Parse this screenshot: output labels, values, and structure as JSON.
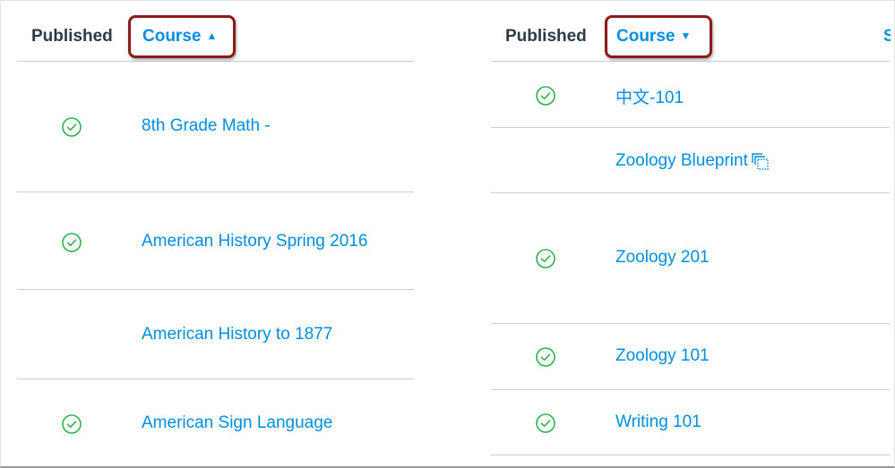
{
  "colors": {
    "link": "#008ee2",
    "published_check": "#2bb34b",
    "header_text": "#2d3b45",
    "highlight": "#8b1a1a",
    "divider": "#c7cdd1"
  },
  "left_table": {
    "headers": {
      "published": "Published",
      "course": "Course",
      "sort_direction": "ascending",
      "sort_icon": "▲"
    },
    "rows": [
      {
        "published": true,
        "course": "8th Grade Math -"
      },
      {
        "published": true,
        "course": "American History Spring 2016"
      },
      {
        "published": false,
        "course": "American History to 1877"
      },
      {
        "published": true,
        "course": "American Sign Language"
      }
    ]
  },
  "right_table": {
    "headers": {
      "published": "Published",
      "course": "Course",
      "sort_direction": "descending",
      "sort_icon": "▼",
      "next_column_partial": "S"
    },
    "rows": [
      {
        "published": true,
        "course": "中文-101",
        "blueprint": false
      },
      {
        "published": false,
        "course": "Zoology Blueprint",
        "blueprint": true,
        "icon": "blueprint-icon"
      },
      {
        "published": true,
        "course": "Zoology 201",
        "blueprint": false
      },
      {
        "published": true,
        "course": "Zoology 101",
        "blueprint": false
      },
      {
        "published": true,
        "course": "Writing 101",
        "blueprint": false
      }
    ]
  }
}
